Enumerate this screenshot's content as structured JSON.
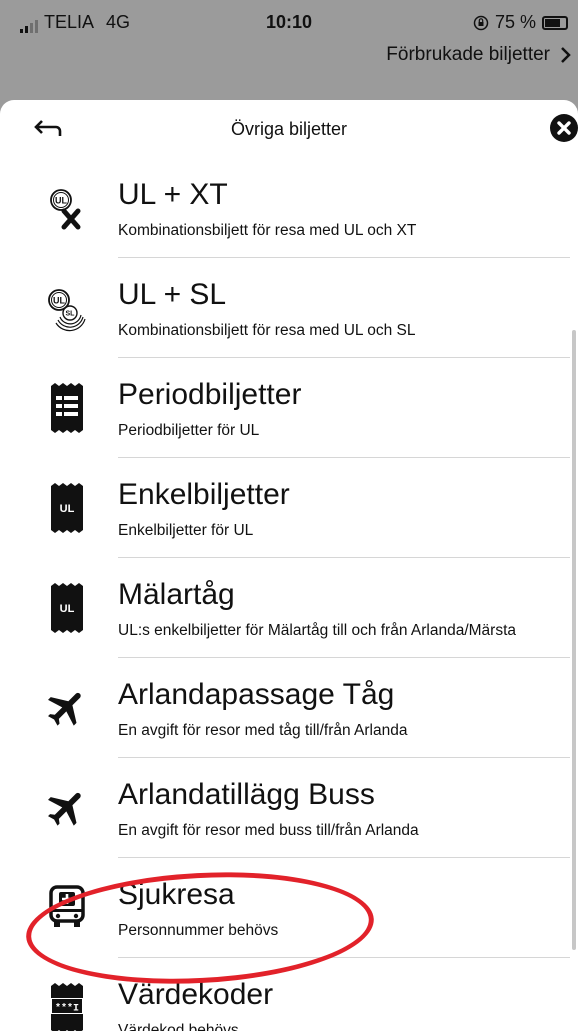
{
  "status_bar": {
    "carrier": "TELIA",
    "network": "4G",
    "time": "10:10",
    "battery_text": "75 %"
  },
  "header_link": {
    "label": "Förbrukade biljetter"
  },
  "sheet": {
    "title": "Övriga biljetter"
  },
  "items": [
    {
      "icon": "ul-xt-icon",
      "title": "UL + XT",
      "subtitle": "Kombinationsbiljett för resa med UL och XT"
    },
    {
      "icon": "ul-sl-icon",
      "title": "UL + SL",
      "subtitle": "Kombinationsbiljett för resa med UL och SL"
    },
    {
      "icon": "period-ticket-icon",
      "title": "Periodbiljetter",
      "subtitle": "Periodbiljetter för UL"
    },
    {
      "icon": "ul-ticket-icon",
      "title": "Enkelbiljetter",
      "subtitle": "Enkelbiljetter för UL"
    },
    {
      "icon": "ul-ticket-icon",
      "title": "Mälartåg",
      "subtitle": "UL:s enkelbiljetter för Mälartåg till och från Arlanda/Märsta"
    },
    {
      "icon": "airplane-icon",
      "title": "Arlandapassage Tåg",
      "subtitle": "En avgift för resor med tåg till/från Arlanda"
    },
    {
      "icon": "airplane-icon",
      "title": "Arlandatillägg Buss",
      "subtitle": "En avgift för resor med buss till/från Arlanda"
    },
    {
      "icon": "medical-bus-icon",
      "title": "Sjukresa",
      "subtitle": "Personnummer behövs"
    },
    {
      "icon": "voucher-code-icon",
      "title": "Värdekoder",
      "subtitle": "Värdekod behövs"
    }
  ],
  "icon_labels": {
    "ul": "UL",
    "sl": "SL",
    "code": "***I"
  },
  "colors": {
    "overlay": "#9b9b9b",
    "highlight": "#e2222a",
    "text": "#111111"
  }
}
